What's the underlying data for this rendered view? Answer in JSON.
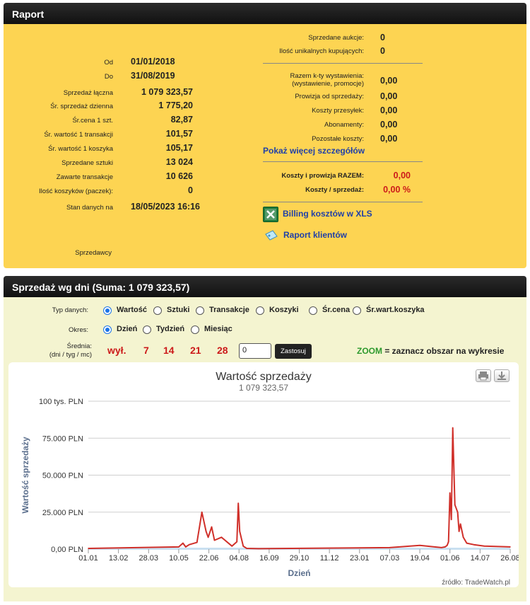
{
  "raport": {
    "title": "Raport",
    "left": [
      {
        "label": "Od",
        "value": "01/01/2018"
      },
      {
        "label": "Do",
        "value": "31/08/2019"
      },
      {
        "label": "Sprzedaż łączna",
        "value": "1 079 323,57"
      },
      {
        "label": "Śr. sprzedaż dzienna",
        "value": "1 775,20"
      },
      {
        "label": "Śr.cena 1 szt.",
        "value": "82,87"
      },
      {
        "label": "Śr. wartość 1 transakcji",
        "value": "101,57"
      },
      {
        "label": "Śr. wartość 1 koszyka",
        "value": "105,17"
      },
      {
        "label": "Sprzedane sztuki",
        "value": "13 024"
      },
      {
        "label": "Zawarte transakcje",
        "value": "10 626"
      },
      {
        "label": "Ilość koszyków (paczek):",
        "value": "0"
      },
      {
        "label": "Stan danych na",
        "value": "18/05/2023 16:16"
      }
    ],
    "sellers_label": "Sprzedawcy",
    "right_top": [
      {
        "label": "Sprzedane aukcje:",
        "value": "0"
      },
      {
        "label": "Ilość unikalnych kupujących:",
        "value": "0"
      }
    ],
    "costs": [
      {
        "label": "Razem k-ty wystawienia:\n(wystawienie, promocje)",
        "value": "0,00"
      },
      {
        "label": "Prowizja od sprzedaży:",
        "value": "0,00"
      },
      {
        "label": "Koszty przesyłek:",
        "value": "0,00"
      },
      {
        "label": "Abonamenty:",
        "value": "0,00"
      },
      {
        "label": "Pozostałe koszty:",
        "value": "0,00"
      }
    ],
    "more_link": "Pokaż więcej szczegółów",
    "totals": [
      {
        "label": "Koszty i prowizja RAZEM:",
        "value": "0,00"
      },
      {
        "label": "Koszty / sprzedaż:",
        "value": "0,00 %"
      }
    ],
    "billing_link": "Billing kosztów w XLS",
    "clients_link": "Raport klientów",
    "red": "#cc1a1a"
  },
  "sales": {
    "title": "Sprzedaż wg dni (Suma: 1 079 323,57)",
    "type_label": "Typ danych:",
    "types": [
      {
        "label": "Wartość",
        "selected": true
      },
      {
        "label": "Sztuki",
        "selected": false
      },
      {
        "label": "Transakcje",
        "selected": false
      },
      {
        "label": "Koszyki",
        "selected": false
      },
      {
        "label": "Śr.cena",
        "selected": false
      },
      {
        "label": "Śr.wart.koszyka",
        "selected": false
      }
    ],
    "period_label": "Okres:",
    "periods": [
      {
        "label": "Dzień",
        "selected": true
      },
      {
        "label": "Tydzień",
        "selected": false
      },
      {
        "label": "Miesiąc",
        "selected": false
      }
    ],
    "avg_label_1": "Średnia:",
    "avg_label_2": "(dni / tyg / mc)",
    "avg_opts": [
      "wył.",
      "7",
      "14",
      "21",
      "28"
    ],
    "avg_input": "0",
    "apply_btn": "Zastosuj",
    "zoom_word": "ZOOM",
    "zoom_text": " = zaznacz obszar na wykresie",
    "zoom_color": "#2e9a2e"
  },
  "chart_data": {
    "type": "area",
    "title": "Wartość sprzedaży",
    "subtitle": "1 079 323,57",
    "xlabel": "Dzień",
    "ylabel": "Wartość sprzedaży",
    "ylim": [
      0,
      100000
    ],
    "y_ticks": [
      "0,00 PLN",
      "25.000 PLN",
      "50.000 PLN",
      "75.000 PLN",
      "100 tys. PLN"
    ],
    "x_ticks": [
      "01.01",
      "13.02",
      "28.03",
      "10.05",
      "22.06",
      "04.08",
      "16.09",
      "29.10",
      "11.12",
      "23.01",
      "07.03",
      "19.04",
      "01.06",
      "14.07",
      "26.08"
    ],
    "series": [
      {
        "color": "#d0302a",
        "x": [
          "01.01",
          "10.05",
          "16.05",
          "20.05",
          "25.05",
          "05.06",
          "12.06",
          "18.06",
          "21.06",
          "26.06",
          "30.06",
          "10.07",
          "25.07",
          "01.08",
          "03.08",
          "05.08",
          "10.08",
          "15.08",
          "01.09",
          "07.03",
          "19.04",
          "20.05",
          "25.05",
          "28.05",
          "30.05",
          "01.06",
          "03.06",
          "05.06",
          "08.06",
          "12.06",
          "14.06",
          "16.06",
          "20.06",
          "25.06",
          "05.07",
          "20.07",
          "26.08"
        ],
        "values": [
          500,
          1500,
          4000,
          1500,
          3000,
          4500,
          25000,
          12000,
          8000,
          15000,
          6000,
          8000,
          2000,
          5000,
          31000,
          12000,
          2000,
          500,
          300,
          1000,
          2500,
          1000,
          1500,
          2500,
          5000,
          38000,
          20000,
          82000,
          30000,
          25000,
          12000,
          17000,
          8000,
          4000,
          3000,
          2000,
          1500
        ]
      }
    ],
    "credit": "źródło: TradeWatch.pl"
  }
}
